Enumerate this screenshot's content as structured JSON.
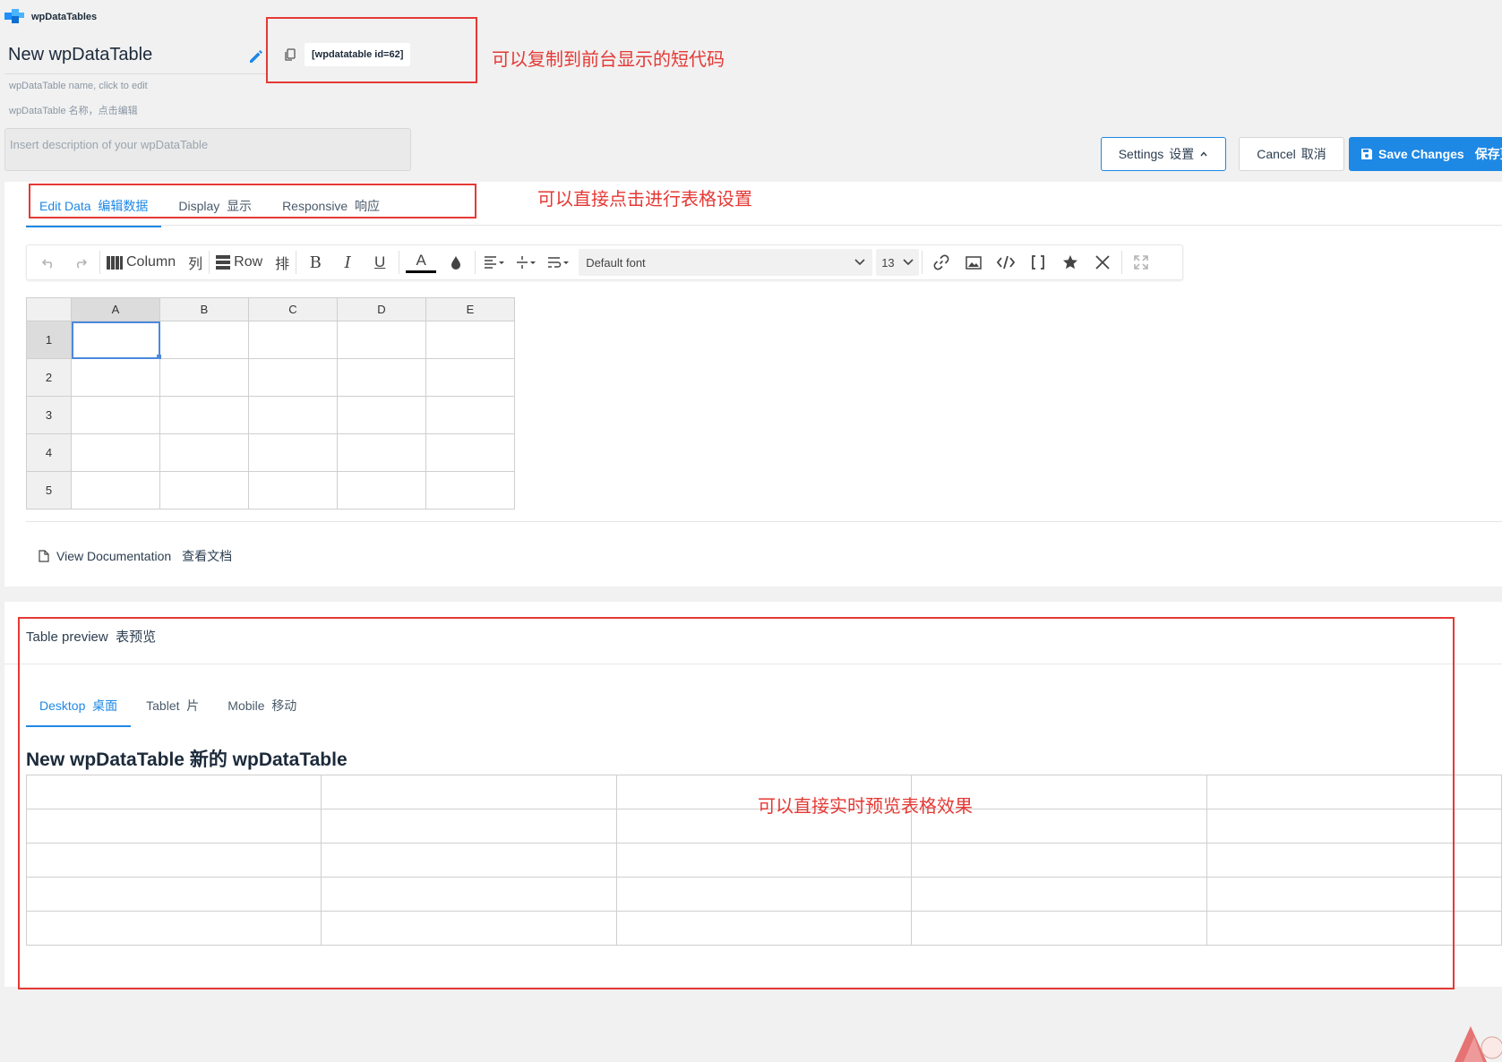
{
  "app": {
    "logo_text": "wpDataTables"
  },
  "header": {
    "table_name": "New wpDataTable",
    "name_hint": "wpDataTable name, click to edit",
    "name_hint_cn": "wpDataTable 名称，点击编辑",
    "description_placeholder": "Insert description of your wpDataTable",
    "shortcode": "[wpdatatable id=62]"
  },
  "actions": {
    "settings_label": "Settings",
    "settings_cn": "设置",
    "cancel_label": "Cancel",
    "cancel_cn": "取消",
    "save_label": "Save Changes",
    "save_cn": "保存更"
  },
  "annotations": {
    "shortcode_note": "可以复制到前台显示的短代码",
    "tabs_note": "可以直接点击进行表格设置",
    "preview_note": "可以直接实时预览表格效果"
  },
  "editor_tabs": [
    {
      "label": "Edit Data",
      "cn": "编辑数据"
    },
    {
      "label": "Display",
      "cn": "显示"
    },
    {
      "label": "Responsive",
      "cn": "响应"
    }
  ],
  "toolbar": {
    "column_label": "Column",
    "column_cn": "列",
    "row_label": "Row",
    "row_cn": "排",
    "font": "Default font",
    "font_size": "13"
  },
  "sheet": {
    "columns": [
      "A",
      "B",
      "C",
      "D",
      "E"
    ],
    "rows": [
      "1",
      "2",
      "3",
      "4",
      "5"
    ]
  },
  "documentation": {
    "label": "View Documentation",
    "cn": "查看文档"
  },
  "preview": {
    "title": "Table preview",
    "title_cn": "表预览",
    "tabs": [
      {
        "label": "Desktop",
        "cn": "桌面"
      },
      {
        "label": "Tablet",
        "cn": "片"
      },
      {
        "label": "Mobile",
        "cn": "移动"
      }
    ],
    "heading": "New wpDataTable  新的 wpDataTable"
  },
  "colors": {
    "accent": "#1e88e5",
    "annotation": "#e53935"
  }
}
